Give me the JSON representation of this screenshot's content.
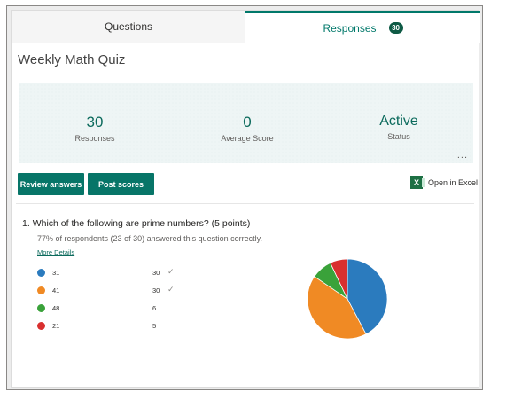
{
  "tabs": {
    "questions_label": "Questions",
    "responses_label": "Responses",
    "responses_count": "30"
  },
  "form_title": "Weekly Math Quiz",
  "stats": [
    {
      "value": "30",
      "label": "Responses"
    },
    {
      "value": "0",
      "label": "Average Score"
    },
    {
      "value": "Active",
      "label": "Status"
    }
  ],
  "more_label": "...",
  "buttons": {
    "review_label": "Review answers",
    "post_label": "Post scores",
    "excel_label": "Open in Excel",
    "excel_icon": "X"
  },
  "question": {
    "number_text": "1.",
    "text": "Which of the following are prime numbers? (5 points)",
    "summary": "77% of respondents (23 of 30) answered this question correctly.",
    "details_link": "More Details",
    "options": [
      {
        "label": "31",
        "count": 30,
        "correct": true,
        "color": "#2b7bbe"
      },
      {
        "label": "41",
        "count": 30,
        "correct": true,
        "color": "#f08a24"
      },
      {
        "label": "48",
        "count": 6,
        "correct": false,
        "color": "#3aa23a"
      },
      {
        "label": "21",
        "count": 5,
        "correct": false,
        "color": "#d9302f"
      }
    ],
    "check_glyph": "✓"
  },
  "colors": {
    "accent": "#077568",
    "pie_blue": "#2b7bbe",
    "pie_orange": "#f08a24",
    "pie_green": "#3aa23a",
    "pie_red": "#d9302f"
  }
}
